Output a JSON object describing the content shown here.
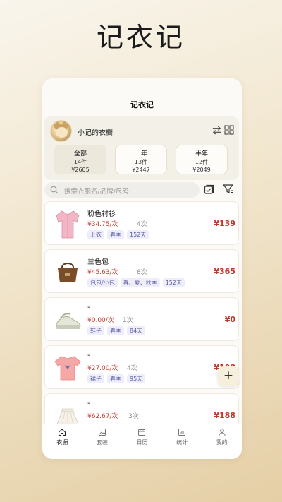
{
  "hero_title": "记衣记",
  "app": {
    "title": "记衣记"
  },
  "profile": {
    "closet_name": "小记的衣橱",
    "icons": [
      "swap-icon",
      "grid-icon"
    ]
  },
  "stats": [
    {
      "label": "全部",
      "count": "14件",
      "total": "¥2605",
      "active": true
    },
    {
      "label": "一年",
      "count": "13件",
      "total": "¥2447",
      "active": false
    },
    {
      "label": "半年",
      "count": "12件",
      "total": "¥2049",
      "active": false
    }
  ],
  "search": {
    "placeholder": "搜索衣服名/品牌/尺码"
  },
  "items": [
    {
      "name": "粉色衬衫",
      "per_use": "¥34.75/次",
      "count": "4次",
      "tags": [
        "上衣",
        "春季",
        "152天"
      ],
      "price": "¥139",
      "thumb": "pink-shirt-icon"
    },
    {
      "name": "兰色包",
      "per_use": "¥45.63/次",
      "count": "8次",
      "tags": [
        "包包/小包",
        "春、夏、秋季",
        "152天"
      ],
      "price": "¥365",
      "thumb": "brown-bag-icon"
    },
    {
      "name": "-",
      "per_use": "¥0.00/次",
      "count": "1次",
      "tags": [
        "鞋子",
        "春季",
        "84天"
      ],
      "price": "¥0",
      "thumb": "sneaker-icon"
    },
    {
      "name": "-",
      "per_use": "¥27.00/次",
      "count": "4次",
      "tags": [
        "裙子",
        "春季",
        "95天"
      ],
      "price": "¥108",
      "thumb": "pink-tshirt-icon"
    },
    {
      "name": "-",
      "per_use": "¥62.67/次",
      "count": "3次",
      "tags": [],
      "price": "¥188",
      "thumb": "white-skirt-icon"
    }
  ],
  "fab": {
    "label": "+"
  },
  "tabbar": [
    {
      "label": "衣橱",
      "icon": "home-icon",
      "active": true
    },
    {
      "label": "套装",
      "icon": "picture-icon",
      "active": false
    },
    {
      "label": "日历",
      "icon": "calendar-icon",
      "active": false
    },
    {
      "label": "统计",
      "icon": "stats-icon",
      "active": false
    },
    {
      "label": "我的",
      "icon": "user-icon",
      "active": false
    }
  ],
  "colors": {
    "accent_red": "#c0392b",
    "tag_text": "#5b5aa0",
    "tag_bg": "#eeeefa"
  }
}
